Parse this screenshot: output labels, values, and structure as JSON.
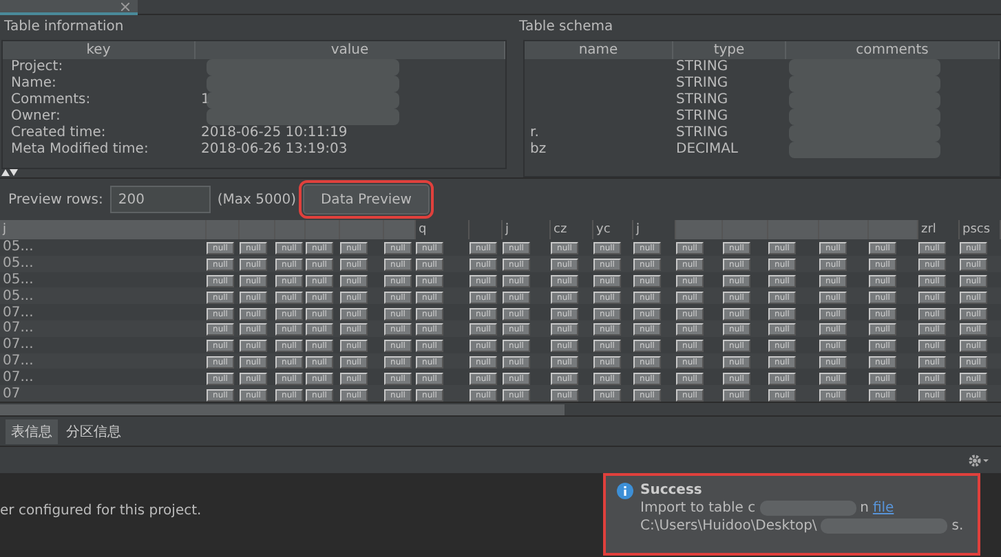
{
  "table_information": {
    "title": "Table information",
    "columns": [
      "key",
      "value"
    ],
    "rows": [
      {
        "key": "Project:",
        "redacted": true
      },
      {
        "key": "Name:",
        "redacted": true
      },
      {
        "key": "Comments:",
        "value": "1",
        "redacted": true
      },
      {
        "key": "Owner:",
        "redacted": true
      },
      {
        "key": "Created time:",
        "value": "2018-06-25 10:11:19",
        "redacted": false
      },
      {
        "key": "Meta Modified time:",
        "value": "2018-06-26 13:19:03",
        "redacted": false
      }
    ]
  },
  "table_schema": {
    "title": "Table schema",
    "columns": [
      "name",
      "type",
      "comments"
    ],
    "rows": [
      {
        "type": "STRING",
        "redacted": true
      },
      {
        "type": "STRING",
        "redacted": true
      },
      {
        "type": "STRING",
        "redacted": true
      },
      {
        "type": "STRING",
        "redacted": true
      },
      {
        "name": "r.",
        "type": "STRING",
        "redacted": true
      },
      {
        "name": "bz",
        "type": "DECIMAL",
        "redacted": true
      }
    ]
  },
  "preview": {
    "label": "Preview rows:",
    "value": "200",
    "hint": "(Max 5000)",
    "button": "Data Preview",
    "highlighted": true
  },
  "data_grid": {
    "columns": [
      {
        "label": "j",
        "redacted": true
      },
      {
        "redacted": true
      },
      {
        "redacted": true
      },
      {
        "redacted": true
      },
      {
        "redacted": true
      },
      {
        "redacted": true
      },
      {
        "redacted": true
      },
      {
        "label": "q",
        "redacted": false
      },
      {
        "redacted": false
      },
      {
        "label": "j",
        "redacted": false
      },
      {
        "label": "cz",
        "redacted": false
      },
      {
        "label": "yc",
        "redacted": false
      },
      {
        "label": "j",
        "redacted": false
      },
      {
        "redacted": true
      },
      {
        "redacted": true
      },
      {
        "redacted": true
      },
      {
        "redacted": true
      },
      {
        "redacted": true
      },
      {
        "label": "zrl",
        "redacted": false
      },
      {
        "label": "pscs",
        "redacted": false
      }
    ],
    "rows": [
      {
        "cells": [
          "05...",
          "null",
          "null",
          "null",
          "null",
          "null",
          "null",
          "null",
          "null",
          "null",
          "null",
          "null",
          "null",
          "null",
          "null",
          "null",
          "null",
          "null",
          "null",
          "null"
        ]
      },
      {
        "cells": [
          "05...",
          "null",
          "null",
          "null",
          "null",
          "null",
          "null",
          "null",
          "null",
          "null",
          "null",
          "null",
          "null",
          "null",
          "null",
          "null",
          "null",
          "null",
          "null",
          "null"
        ]
      },
      {
        "cells": [
          "05...",
          "null",
          "null",
          "null",
          "null",
          "null",
          "null",
          "null",
          "null",
          "null",
          "null",
          "null",
          "null",
          "null",
          "null",
          "null",
          "null",
          "null",
          "null",
          "null"
        ]
      },
      {
        "cells": [
          "05...",
          "null",
          "null",
          "null",
          "null",
          "null",
          "null",
          "null",
          "null",
          "null",
          "null",
          "null",
          "null",
          "null",
          "null",
          "null",
          "null",
          "null",
          "null",
          "null"
        ]
      },
      {
        "cells": [
          "07...",
          "null",
          "null",
          "null",
          "null",
          "null",
          "null",
          "null",
          "null",
          "null",
          "null",
          "null",
          "null",
          "null",
          "null",
          "null",
          "null",
          "null",
          "null",
          "null"
        ]
      },
      {
        "cells": [
          "07...",
          "null",
          "null",
          "null",
          "null",
          "null",
          "null",
          "null",
          "null",
          "null",
          "null",
          "null",
          "null",
          "null",
          "null",
          "null",
          "null",
          "null",
          "null",
          "null"
        ]
      },
      {
        "cells": [
          "07...",
          "null",
          "null",
          "null",
          "null",
          "null",
          "null",
          "null",
          "null",
          "null",
          "null",
          "null",
          "null",
          "null",
          "null",
          "null",
          "null",
          "null",
          "null",
          "null"
        ]
      },
      {
        "cells": [
          "07...",
          "null",
          "null",
          "null",
          "null",
          "null",
          "null",
          "null",
          "null",
          "null",
          "null",
          "null",
          "null",
          "null",
          "null",
          "null",
          "null",
          "null",
          "null",
          "null"
        ]
      },
      {
        "cells": [
          "07...",
          "null",
          "null",
          "null",
          "null",
          "null",
          "null",
          "null",
          "null",
          "null",
          "null",
          "null",
          "null",
          "null",
          "null",
          "null",
          "null",
          "null",
          "null",
          "null"
        ]
      },
      {
        "cells": [
          "07",
          "null",
          "null",
          "null",
          "null",
          "null",
          "null",
          "null",
          "null",
          "null",
          "null",
          "null",
          "null",
          "null",
          "null",
          "null",
          "null",
          "null",
          "null",
          "null"
        ]
      }
    ]
  },
  "bottom_tabs": [
    {
      "label": "表信息",
      "selected": true
    },
    {
      "label": "分区信息",
      "selected": false
    }
  ],
  "console": {
    "lines": [
      "er configured for this project."
    ]
  },
  "notification": {
    "title": "Success",
    "line_1": "Import to table c",
    "link_prefix": "n",
    "link": "file",
    "line_2": "C:\\Users\\Huidoo\\Desktop\\",
    "line_2_end": "s.",
    "highlighted": true
  }
}
